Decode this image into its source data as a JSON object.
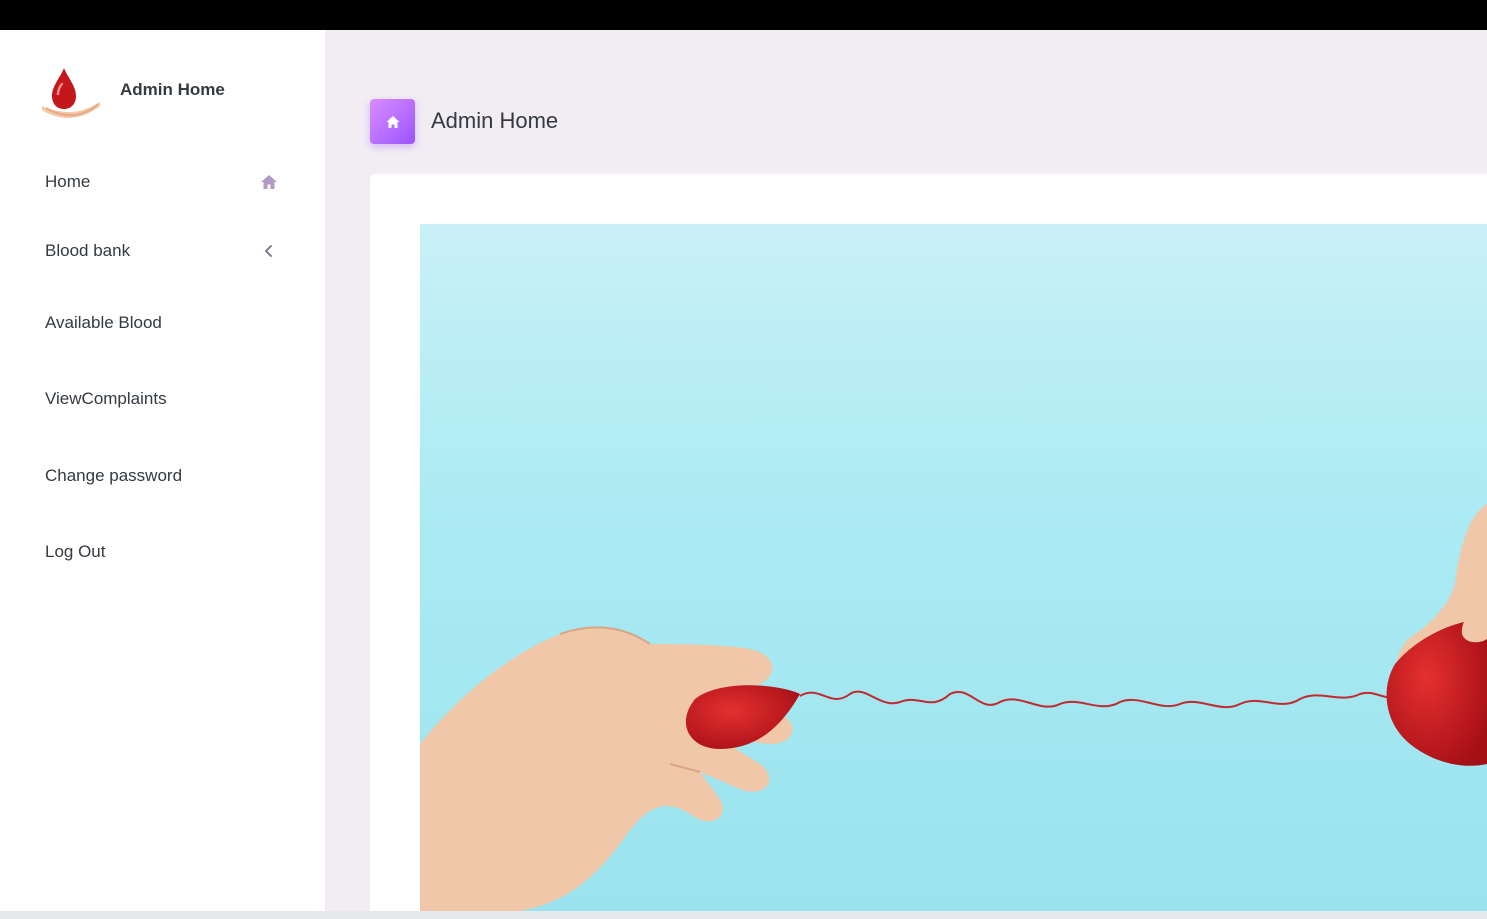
{
  "sidebar": {
    "brand_title": "Admin Home",
    "items": [
      {
        "label": "Home",
        "icon": "home-icon"
      },
      {
        "label": "Blood bank",
        "icon": "chevron-left-icon"
      },
      {
        "label": "Available Blood"
      },
      {
        "label": "ViewComplaints"
      },
      {
        "label": "Change password"
      },
      {
        "label": "Log Out"
      }
    ]
  },
  "header": {
    "title": "Admin Home",
    "icon": "home-icon"
  },
  "colors": {
    "accent_gradient_start": "#da8cff",
    "accent_gradient_end": "#9a55ff",
    "page_background": "#f2edf3",
    "hero_background": "#a6e6f0",
    "blood_red": "#c4161c"
  }
}
